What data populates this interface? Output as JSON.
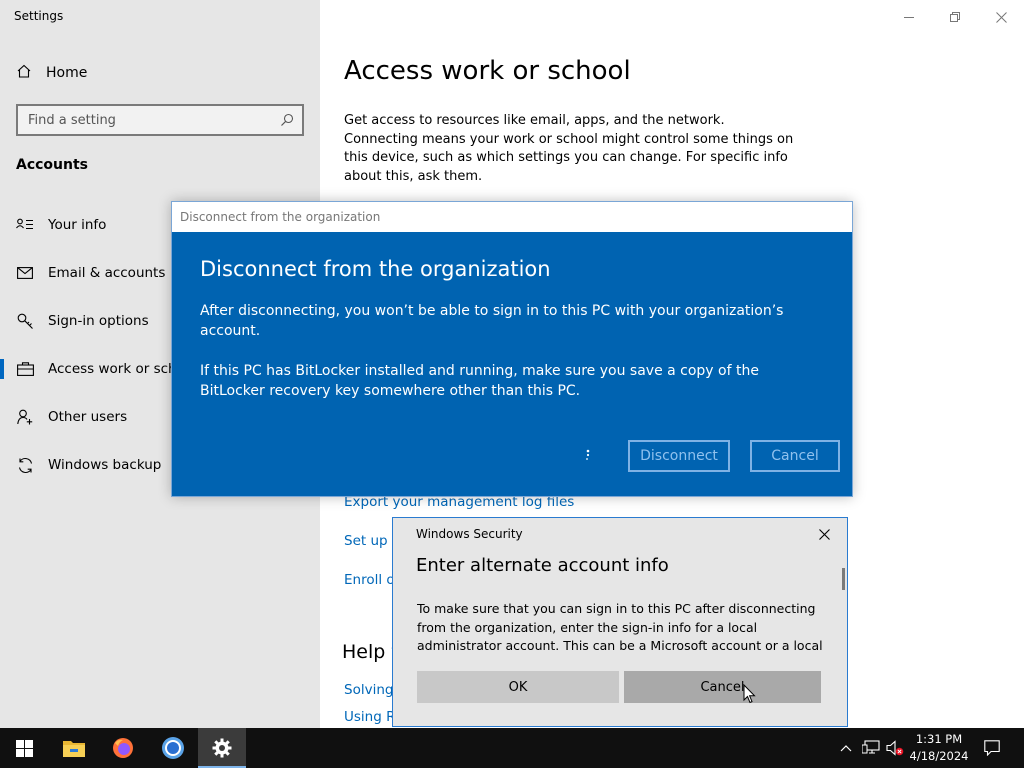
{
  "window": {
    "app_title": "Settings"
  },
  "sidebar": {
    "home_label": "Home",
    "search_placeholder": "Find a setting",
    "section_title": "Accounts",
    "items": [
      {
        "label": "Your info",
        "icon": "person-list-icon"
      },
      {
        "label": "Email & accounts",
        "icon": "mail-icon"
      },
      {
        "label": "Sign-in options",
        "icon": "key-icon"
      },
      {
        "label": "Access work or scho",
        "icon": "briefcase-icon"
      },
      {
        "label": "Other users",
        "icon": "person-add-icon"
      },
      {
        "label": "Windows backup",
        "icon": "sync-icon"
      }
    ],
    "active_index": 3
  },
  "main": {
    "title": "Access work or school",
    "description": "Get access to resources like email, apps, and the network. Connecting means your work or school might control some things on this device, such as which settings you can change. For specific info about this, ask them.",
    "links": {
      "export_logs": "Export your management log files",
      "setup": "Set up a",
      "enroll": "Enroll o",
      "solving": "Solving",
      "using": "Using R"
    },
    "help_title": "Help t"
  },
  "disconnect_dialog": {
    "titlebar": "Disconnect from the organization",
    "heading": "Disconnect from the organization",
    "para1": "After disconnecting, you won’t be able to sign in to this PC with your organization’s account.",
    "para2": "If this PC has BitLocker installed and running, make sure you save a copy of the BitLocker recovery key somewhere other than this PC.",
    "disconnect_label": "Disconnect",
    "cancel_label": "Cancel"
  },
  "security_dialog": {
    "title": "Windows Security",
    "heading": "Enter alternate account info",
    "body": "To make sure that you can sign in to this PC after disconnecting from the organization, enter the sign-in info for a local administrator account. This can be a Microsoft account or a local",
    "ok_label": "OK",
    "cancel_label": "Cancel"
  },
  "taskbar": {
    "time": "1:31 PM",
    "date": "4/18/2024",
    "apps": [
      "start-icon",
      "file-explorer-icon",
      "firefox-icon",
      "chrome-icon",
      "settings-gear-icon"
    ]
  },
  "colors": {
    "accent": "#0067c0",
    "dialog_blue": "#0063b1",
    "link": "#0067b8",
    "taskbar": "#101010"
  }
}
